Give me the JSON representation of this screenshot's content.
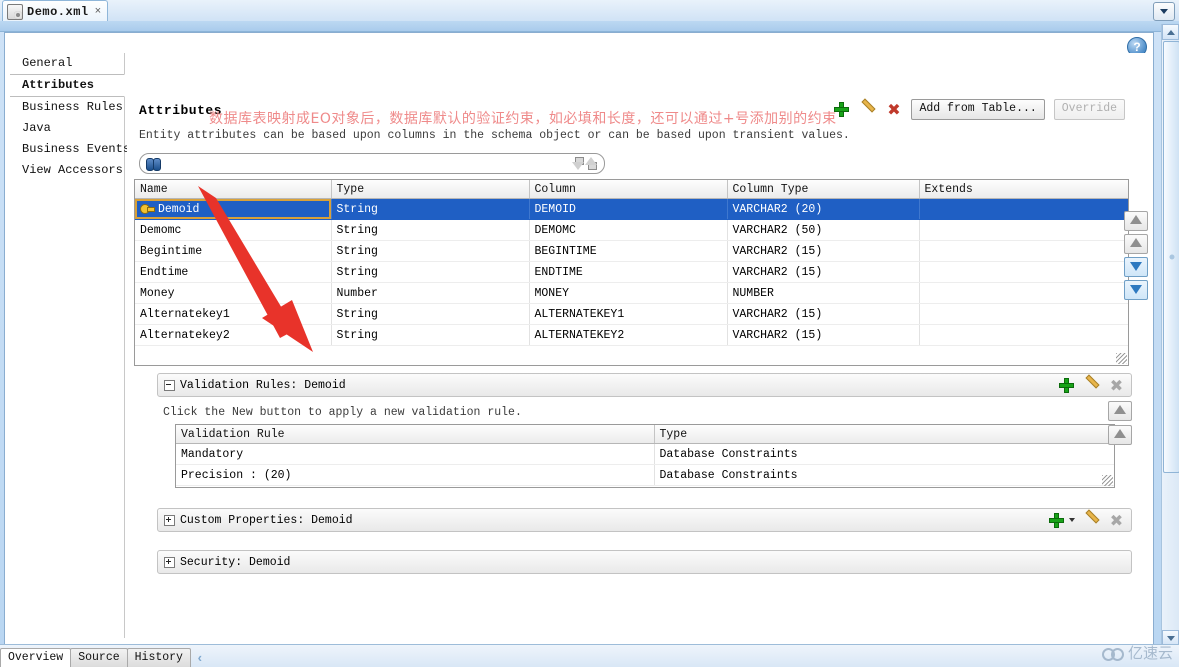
{
  "window": {
    "doc_tab_label": "Demo.xml",
    "doc_tab_close": "×",
    "help_label": "?"
  },
  "nav": {
    "items": [
      {
        "label": "General",
        "selected": false
      },
      {
        "label": "Attributes",
        "selected": true
      },
      {
        "label": "Business Rules",
        "selected": false
      },
      {
        "label": "Java",
        "selected": false
      },
      {
        "label": "Business Events",
        "selected": false
      },
      {
        "label": "View Accessors",
        "selected": false
      }
    ]
  },
  "page": {
    "title": "Attributes",
    "description": "Entity attributes can be based upon columns in the schema object or can be based upon transient values.",
    "annotation": "数据库表映射成EO对象后，数据库默认的验证约束，如必填和长度，还可以通过+号添加别的约束",
    "annotation_color": "#ef8a8a"
  },
  "toolbar": {
    "add_label": "+",
    "edit_label": "edit",
    "delete_label": "✖",
    "add_from_table_label": "Add from Table...",
    "override_label": "Override"
  },
  "search": {
    "value": "",
    "placeholder": ""
  },
  "attributes_grid": {
    "columns": [
      "Name",
      "Type",
      "Column",
      "Column Type",
      "Extends"
    ],
    "rows": [
      {
        "name": "Demoid",
        "type": "String",
        "column": "DEMOID",
        "column_type": "VARCHAR2 (20)",
        "extends": "",
        "selected": true,
        "key": true
      },
      {
        "name": "Demomc",
        "type": "String",
        "column": "DEMOMC",
        "column_type": "VARCHAR2 (50)",
        "extends": "",
        "selected": false,
        "key": false
      },
      {
        "name": "Begintime",
        "type": "String",
        "column": "BEGINTIME",
        "column_type": "VARCHAR2 (15)",
        "extends": "",
        "selected": false,
        "key": false
      },
      {
        "name": "Endtime",
        "type": "String",
        "column": "ENDTIME",
        "column_type": "VARCHAR2 (15)",
        "extends": "",
        "selected": false,
        "key": false
      },
      {
        "name": "Money",
        "type": "Number",
        "column": "MONEY",
        "column_type": "NUMBER",
        "extends": "",
        "selected": false,
        "key": false
      },
      {
        "name": "Alternatekey1",
        "type": "String",
        "column": "ALTERNATEKEY1",
        "column_type": "VARCHAR2 (15)",
        "extends": "",
        "selected": false,
        "key": false
      },
      {
        "name": "Alternatekey2",
        "type": "String",
        "column": "ALTERNATEKEY2",
        "column_type": "VARCHAR2 (15)",
        "extends": "",
        "selected": false,
        "key": false
      }
    ]
  },
  "validation_panel": {
    "header": "Validation Rules: Demoid",
    "hint": "Click the New button to apply a new validation rule.",
    "columns": [
      "Validation Rule",
      "Type"
    ],
    "rows": [
      {
        "rule": "Mandatory",
        "type": "Database Constraints"
      },
      {
        "rule": "Precision : (20)",
        "type": "Database Constraints"
      }
    ]
  },
  "custom_properties_panel": {
    "header": "Custom Properties: Demoid"
  },
  "security_panel": {
    "header": "Security: Demoid"
  },
  "bottom_tabs": {
    "items": [
      {
        "label": "Overview",
        "active": true
      },
      {
        "label": "Source",
        "active": false
      },
      {
        "label": "History",
        "active": false
      }
    ],
    "chevron": "‹"
  },
  "watermark": {
    "text": "亿速云"
  }
}
